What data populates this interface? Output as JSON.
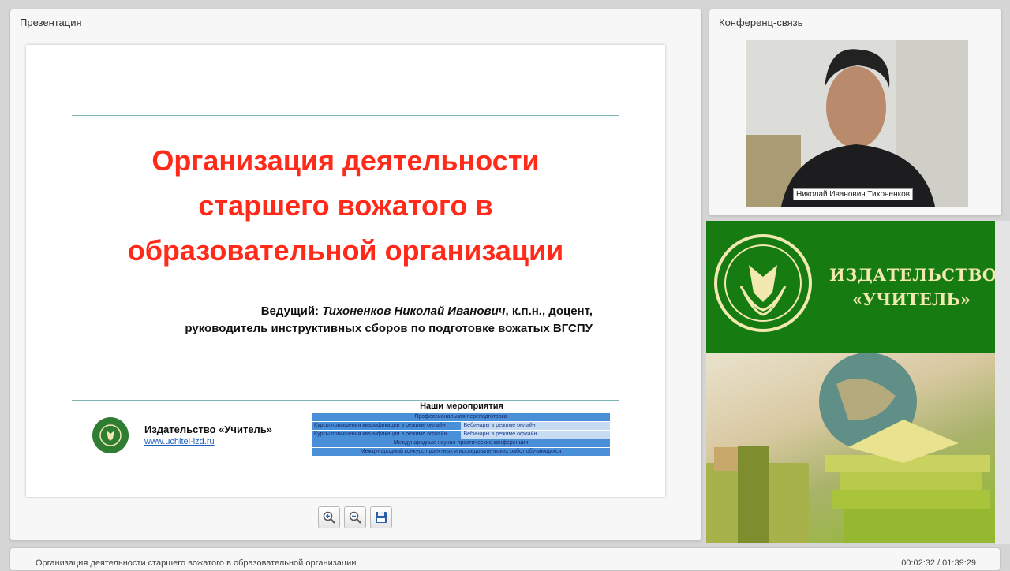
{
  "presentation_panel": {
    "title": "Презентация"
  },
  "conference_panel": {
    "title": "Конференц-связь",
    "participant_name": "Николай Иванович Тихоненков"
  },
  "slide": {
    "title_line1": "Организация деятельности",
    "title_line2": "старшего вожатого в",
    "title_line3": "образовательной организации",
    "presenter_prefix": "Ведущий: ",
    "presenter_name": "Тихоненков Николай Иванович",
    "presenter_suffix": ", к.п.н., доцент,",
    "presenter_line2": "руководитель инструктивных сборов по подготовке вожатых ВГСПУ",
    "publisher_name": "Издательство «Учитель»",
    "publisher_url": "www.uchitel-izd.ru",
    "events_title": "Наши мероприятия",
    "events": [
      [
        "Профессиональная переподготовка"
      ],
      [
        "Курсы повышения квалификации в режиме онлайн",
        "Вебинары в режиме онлайн"
      ],
      [
        "Курсы повышения квалификации в режиме офлайн",
        "Вебинары в режиме офлайн"
      ],
      [
        "Международные научно-практические конференции"
      ],
      [
        "Международный конкурс проектных и исследовательских работ обучающихся"
      ]
    ]
  },
  "toolbar": {
    "zoom_in": "zoom-in",
    "zoom_out": "zoom-out",
    "save": "save"
  },
  "ad": {
    "brand_line1": "ИЗДАТЕЛЬСТВО",
    "brand_line2": "«УЧИТЕЛЬ»"
  },
  "footer": {
    "title": "Организация деятельности старшего вожатого в образовательной организации",
    "time": "00:02:32 / 01:39:29"
  },
  "colors": {
    "slide_title": "#ff2a1a",
    "ad_green": "#167c12",
    "event_blue": "#4a90d8"
  }
}
